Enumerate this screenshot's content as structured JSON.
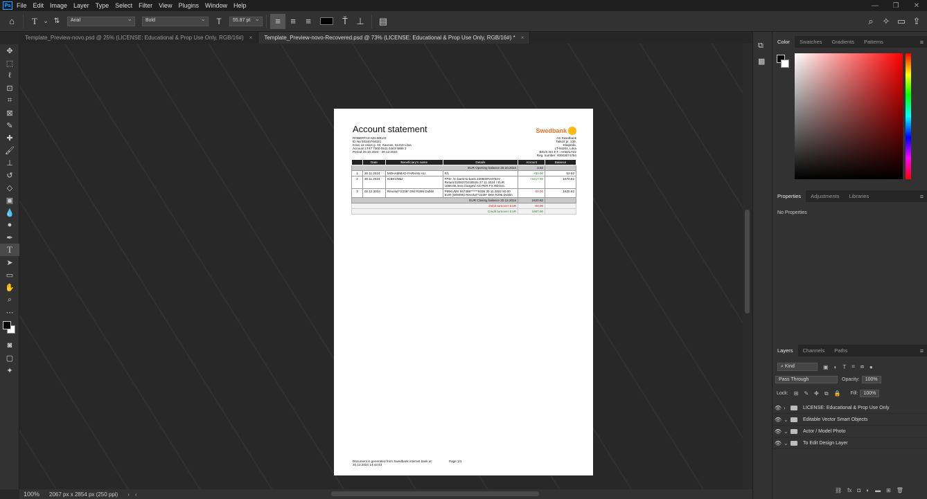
{
  "menu": [
    "File",
    "Edit",
    "Image",
    "Layer",
    "Type",
    "Select",
    "Filter",
    "View",
    "Plugins",
    "Window",
    "Help"
  ],
  "ps_logo": "Ps",
  "options": {
    "font_family": "Arial",
    "font_style": "Bold",
    "font_size": "55.87 pt"
  },
  "tabs": [
    {
      "label": "Template_Preview-novo.psd @ 25% (LICENSE: Educational & Prop Use Only, RGB/16#)",
      "close": "×"
    },
    {
      "label": "Template_Preview-novo-Recovered.psd @ 73% (LICENSE: Educational & Prop Use Only, RGB/16#) *",
      "close": "×"
    }
  ],
  "document": {
    "title": "Account statement",
    "bank_logo": "Swedbank",
    "customer": [
      "ROBERTAS KELMELIS",
      "ID No 50340764021",
      "Kovo 11-osios g. 40, Kaunas, 51319 Litva",
      "Account LT47 7300 0511 0443 4898 3",
      "Period 20.10.2024 - 20.12.2024"
    ],
    "bank": [
      "AS Swedbank",
      "Taikos pr. 139,",
      "Klaipėda,",
      "LT-94204, Litva",
      "BIC/S.W.I.F.T.: HABALT22",
      "Reg. number: 40003074764"
    ],
    "headers": [
      "",
      "Date",
      "Beneficiary's name",
      "Details",
      "Amount",
      "Balance"
    ],
    "opening": {
      "label": "EUR Opening balance 20.10.2024",
      "value": "3.92"
    },
    "rows": [
      {
        "n": "1",
        "date": "30.11.2024",
        "name": "MOHAMMAD FARHAN ALI",
        "details": "F/L",
        "amount": "+50.00",
        "balance": "53.92",
        "sign": "pos"
      },
      {
        "n": "2",
        "date": "30.11.2024",
        "name": "ICBKCNBJ",
        "details": "FPD- /rc bank-to-bank 220800F24782V Return/220827021851N 27.11.2024 / EUR 1668.00 /exs charges/ AS PER FX REGUL",
        "amount": "+1617.90",
        "balance": "1670.82",
        "sign": "pos"
      },
      {
        "n": "3",
        "date": "02.12.2024",
        "name": "Revolut**2238* D02 R296 Dublin",
        "details": "PIRKUMS 557388******9338 30.11.2022 50.00 EUR (505095) Revolut**2238* D02 R296 Dublin",
        "amount": "-50.00",
        "balance": "1620.82",
        "sign": "neg"
      }
    ],
    "closing": {
      "label": "EUR Closing balance 20.12.2024",
      "value": "1620.82"
    },
    "debit": {
      "label": "Debit turnover EUR",
      "value": "-50.00"
    },
    "credit": {
      "label": "Credit turnover EUR",
      "value": "1667.90"
    },
    "footer1": "Document is generated from Swedbank internet bank at: 20.12.2024 14:43:43",
    "footer2": "Page 1/1"
  },
  "status": {
    "zoom": "100%",
    "size": "2067 px x 2854 px (250 ppi)"
  },
  "color_tabs": [
    "Color",
    "Swatches",
    "Gradients",
    "Patterns"
  ],
  "props_tabs": [
    "Properties",
    "Adjustments",
    "Libraries"
  ],
  "props_empty": "No Properties",
  "layer_tabs": [
    "Layers",
    "Channels",
    "Paths"
  ],
  "layers_ctl": {
    "kind": "Kind",
    "blend": "Pass Through",
    "opacity_label": "Opacity:",
    "opacity": "100%",
    "lock_label": "Lock:",
    "fill_label": "Fill:",
    "fill": "100%"
  },
  "layers": [
    "LICENSE: Educational & Prop Use Only",
    "Editable Vector Smart Objects",
    "Actor / Model Photo",
    "To Edit Design Layer"
  ]
}
